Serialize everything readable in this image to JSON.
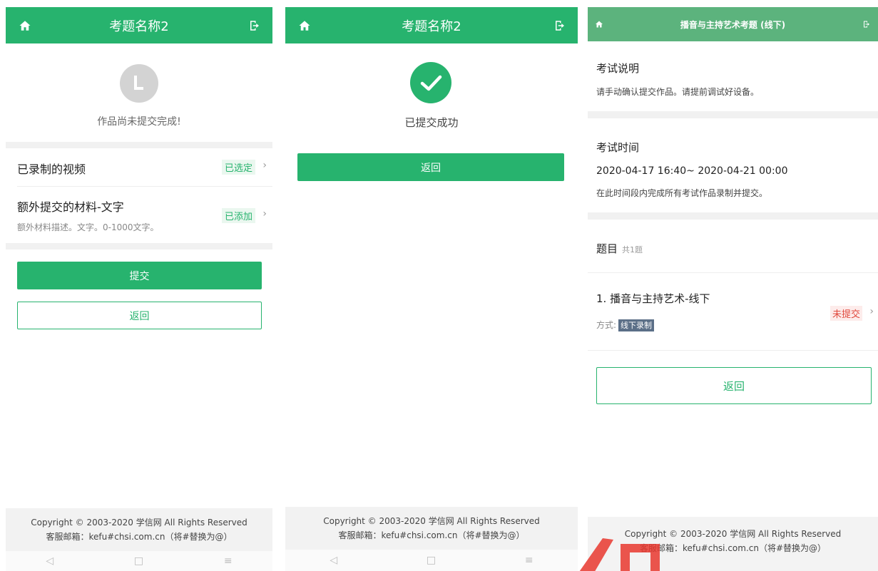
{
  "colors": {
    "brand_green": "#27b36e",
    "header_green_p3": "#5cb37d",
    "red": "#e0483c",
    "tag_blue": "#5b6f87"
  },
  "footer": {
    "copyright": "Copyright © 2003-2020 学信网 All Rights Reserved",
    "email": "客服邮箱：kefu#chsi.com.cn（将#替换为@）"
  },
  "panel1": {
    "header_title": "考题名称2",
    "status": "作品尚未提交完成!",
    "rows": [
      {
        "title": "已录制的视频",
        "badge": "已选定"
      },
      {
        "title": "额外提交的材料-文字",
        "desc": "额外材料描述。文字。0-1000文字。",
        "badge": "已添加"
      }
    ],
    "submit_label": "提交",
    "back_label": "返回"
  },
  "panel2": {
    "header_title": "考题名称2",
    "status": "已提交成功",
    "back_label": "返回"
  },
  "panel3": {
    "header_title": "播音与主持艺术考题 (线下)",
    "exam_desc_title": "考试说明",
    "exam_desc_text": "请手动确认提交作品。请提前调试好设备。",
    "exam_time_title": "考试时间",
    "exam_time_range": "2020-04-17 16:40~ 2020-04-21 00:00",
    "exam_time_note": "在此时间段内完成所有考试作品录制并提交。",
    "questions_title": "题目",
    "questions_count": "共1题",
    "question_name": "1. 播音与主持艺术-线下",
    "method_label": "方式:",
    "method_value": "线下录制",
    "status": "未提交",
    "back_label": "返回"
  },
  "icons": {
    "home": "home-icon",
    "exit": "exit-icon",
    "clock": "clock-icon",
    "check": "check-circle-icon",
    "chevron": "chevron-right-icon"
  },
  "chevron_glyph": "›",
  "nav_glyphs": {
    "back": "◁",
    "home": "□",
    "menu": "≡"
  }
}
